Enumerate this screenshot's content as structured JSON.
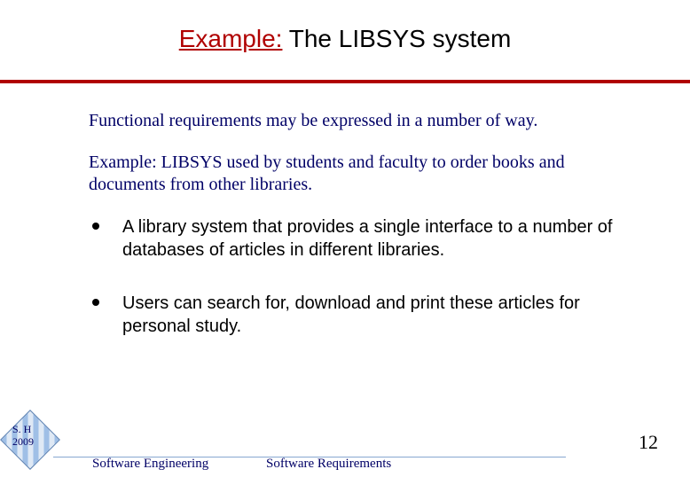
{
  "title": {
    "prefix": "Example:",
    "main": " The LIBSYS system"
  },
  "paragraphs": {
    "intro": "Functional requirements may be expressed in a number of way.",
    "context": "Example: LIBSYS used by students and faculty to order books and documents from other libraries."
  },
  "bullets": [
    "A library system that provides a single interface to a number of databases of articles in different libraries.",
    "Users can search for, download and print these articles for personal study."
  ],
  "footer": {
    "author_line1": "S. H",
    "author_line2": "2009",
    "course": "Software Engineering",
    "topic": "Software Requirements",
    "page": "12"
  }
}
